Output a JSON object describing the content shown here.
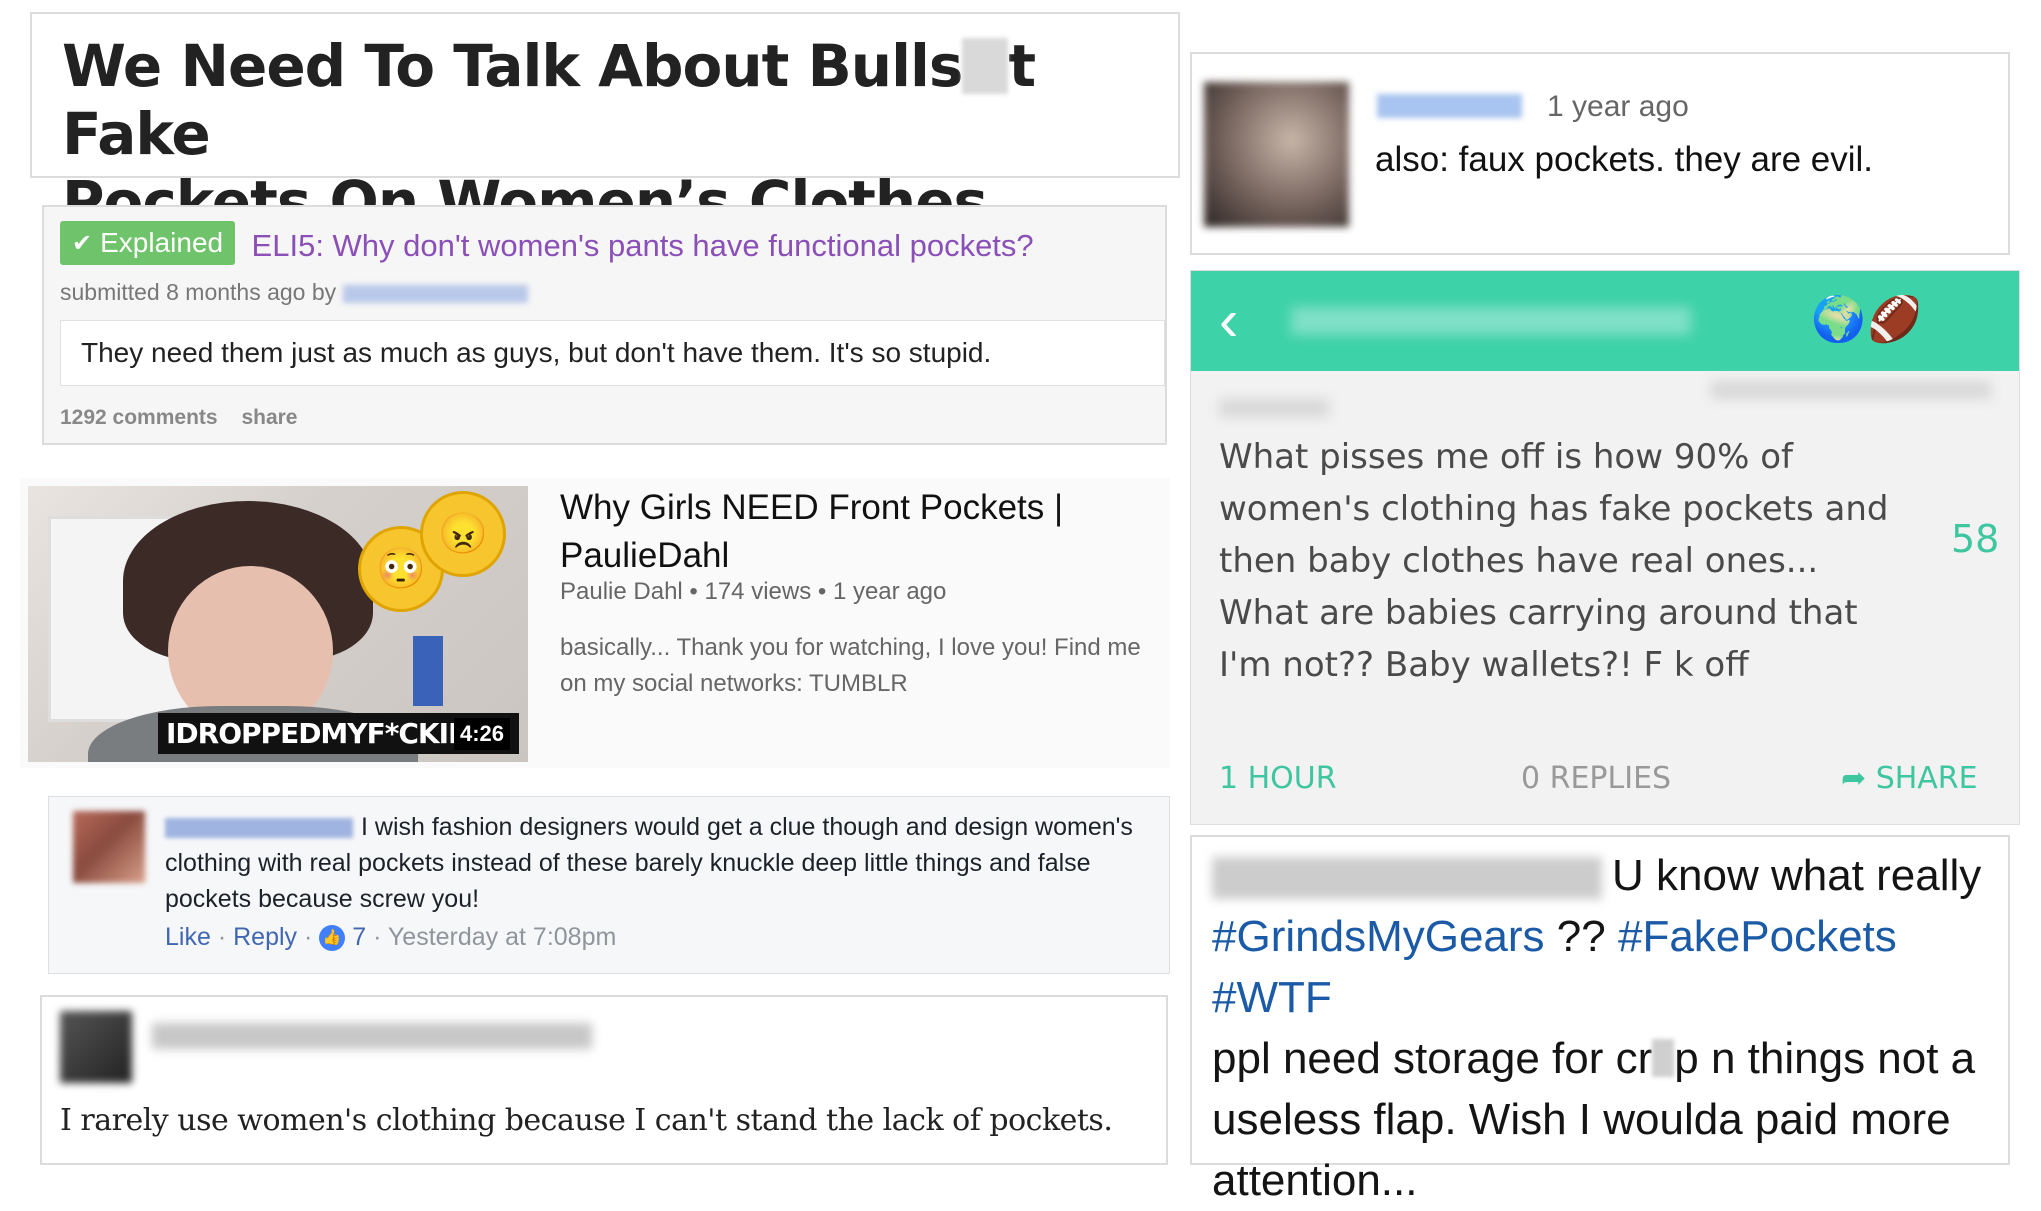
{
  "headline": {
    "line1_a": "We Need To Talk About Bulls",
    "line1_b": "t Fake",
    "line2": "Pockets On Women’s Clothes"
  },
  "reddit": {
    "flair": "Explained",
    "title": "ELI5: Why don't women's pants have functional pockets?",
    "submitted": "submitted 8 months ago by",
    "body": "They need them just as much as guys, but don't have them. It's so stupid.",
    "comments": "1292 comments",
    "share": "share"
  },
  "youtube": {
    "title": "Why Girls NEED Front Pockets | PaulieDahl",
    "meta": "Paulie Dahl • 174 views • 1 year ago",
    "description": "basically... Thank you for watching, I love you! Find me on my social networks: TUMBLR",
    "caption": "IDROPPEDMYF*CKINGF",
    "duration": "4:26"
  },
  "facebook": {
    "text": "I wish fashion designers would get a clue though and design women's clothing with real pockets instead of these barely knuckle deep little things and false pockets because screw you!",
    "like": "Like",
    "reply": "Reply",
    "count": "7",
    "time": "Yesterday at 7:08pm"
  },
  "comment": {
    "text": "I rarely use women's clothing because I can't stand the lack of pockets."
  },
  "top_comment": {
    "time": "1 year ago",
    "text": "also: faux pockets. they are evil."
  },
  "yikyak": {
    "text": "What pisses me off is how 90% of women's clothing has fake pockets and then baby clothes have real ones... What are babies carrying around that I'm not?? Baby wallets?! F    k off",
    "votes": "58",
    "time": "1 HOUR",
    "replies": "0 REPLIES",
    "share": "SHARE"
  },
  "tweet": {
    "intro": "U know what really",
    "tag1": "#GrindsMyGears",
    "marks": "??",
    "tag2": "#FakePockets",
    "tag3": "#WTF",
    "line_a": "ppl need storage for cr",
    "line_b": "p n things not a useless flap. Wish I woulda paid more attention..."
  }
}
